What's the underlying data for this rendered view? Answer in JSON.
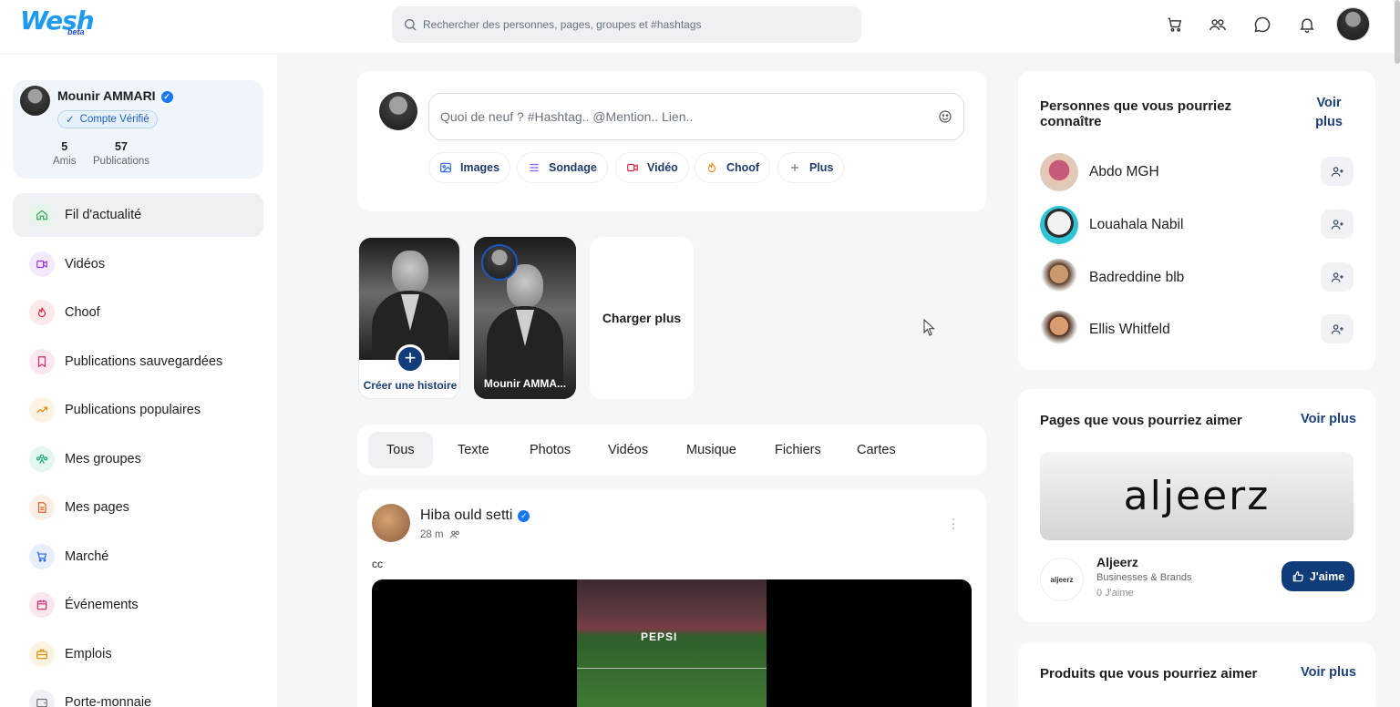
{
  "header": {
    "logo": "Wesh",
    "logo_sub": "beta",
    "search_placeholder": "Rechercher des personnes, pages, groupes et #hashtags",
    "icons": [
      "cart-icon",
      "friends-icon",
      "chat-icon",
      "bell-icon"
    ]
  },
  "profile": {
    "name": "Mounir AMMARI",
    "badge": "Compte Vérifié",
    "friends_count": "5",
    "friends_label": "Amis",
    "posts_count": "57",
    "posts_label": "Publications"
  },
  "sidebar": {
    "items": [
      {
        "label": "Fil d'actualité",
        "icon": "home-icon",
        "color": "#2e9e4f",
        "bg": "#e6f5ea"
      },
      {
        "label": "Vidéos",
        "icon": "video-icon",
        "color": "#9b30d9",
        "bg": "#f3e8fc"
      },
      {
        "label": "Choof",
        "icon": "flame-icon",
        "color": "#e0243b",
        "bg": "#fde8ea"
      },
      {
        "label": "Publications sauvegardées",
        "icon": "bookmark-icon",
        "color": "#d6246e",
        "bg": "#fce7f0"
      },
      {
        "label": "Publications populaires",
        "icon": "trending-icon",
        "color": "#e08a00",
        "bg": "#fdf3e2"
      },
      {
        "label": "Mes groupes",
        "icon": "groups-icon",
        "color": "#14a37f",
        "bg": "#e3f6f0"
      },
      {
        "label": "Mes pages",
        "icon": "page-icon",
        "color": "#e0602b",
        "bg": "#fdeee6"
      },
      {
        "label": "Marché",
        "icon": "cart-icon",
        "color": "#2563eb",
        "bg": "#e7eefc"
      },
      {
        "label": "Événements",
        "icon": "calendar-icon",
        "color": "#d1246a",
        "bg": "#fce7ef"
      },
      {
        "label": "Emplois",
        "icon": "briefcase-icon",
        "color": "#d98b00",
        "bg": "#fdf3e0"
      },
      {
        "label": "Porte-monnaie",
        "icon": "wallet-icon",
        "color": "#6b7280",
        "bg": "#eef0f3"
      }
    ]
  },
  "composer": {
    "placeholder": "Quoi de neuf ? #Hashtag.. @Mention.. Lien..",
    "buttons": [
      {
        "label": "Images",
        "icon": "image-icon",
        "color": "#2563eb"
      },
      {
        "label": "Sondage",
        "icon": "poll-icon",
        "color": "#8b5cf6"
      },
      {
        "label": "Vidéo",
        "icon": "video-icon",
        "color": "#e0243b"
      },
      {
        "label": "Choof",
        "icon": "flame-icon",
        "color": "#f08a24"
      },
      {
        "label": "Plus",
        "icon": "plus-icon",
        "color": "#6b7280"
      }
    ]
  },
  "stories": {
    "create_label": "Créer une histoire",
    "user_story_label": "Mounir AMMA...",
    "load_more": "Charger plus"
  },
  "tabs": [
    "Tous",
    "Texte",
    "Photos",
    "Vidéos",
    "Musique",
    "Fichiers",
    "Cartes"
  ],
  "post": {
    "author": "Hiba ould setti",
    "time": "28 m",
    "text": "cc",
    "video_banner": "PEPSI"
  },
  "people_card": {
    "title": "Personnes que vous pourriez connaître",
    "voir_plus": "Voir plus",
    "people": [
      {
        "name": "Abdo MGH"
      },
      {
        "name": "Louahala Nabil"
      },
      {
        "name": "Badreddine blb"
      },
      {
        "name": "Ellis Whitfeld"
      }
    ]
  },
  "pages_card": {
    "title": "Pages que vous pourriez aimer",
    "voir_plus": "Voir plus",
    "banner_text": "aljeerz",
    "logo_text": "aljeerz",
    "page_name": "Aljeerz",
    "category": "Businesses & Brands",
    "likes": "0 J'aime",
    "like_button": "J'aime"
  },
  "products_card": {
    "title": "Produits que vous pourriez aimer",
    "voir_plus": "Voir plus"
  },
  "colors": {
    "brand": "#1d9bf0",
    "primary_dark": "#103d7a",
    "verified": "#1877f2"
  }
}
